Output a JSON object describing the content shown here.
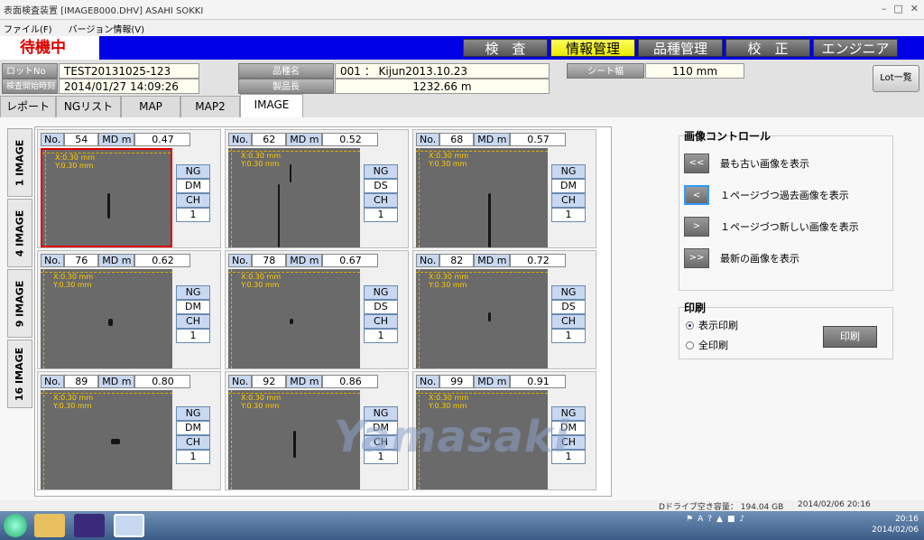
{
  "window": {
    "title": "表面検査装置 [IMAGE8000.DHV] ASAHI SOKKI"
  },
  "menu": [
    "ファイル(F)",
    "バージョン情報(V)"
  ],
  "status": {
    "text": "待機中"
  },
  "nav": [
    {
      "label": "検　査",
      "active": false
    },
    {
      "label": "情報管理",
      "active": true
    },
    {
      "label": "品種管理",
      "active": false
    },
    {
      "label": "校　正",
      "active": false
    },
    {
      "label": "エンジニア",
      "active": false
    }
  ],
  "info": {
    "lot_label": "ロットNo",
    "lot_value": "TEST20131025-123",
    "start_label": "検査開始時刻",
    "start_value": "2014/01/27 14:09:26",
    "kind_label": "品種名",
    "kind_value": "001 ： Kijun2013.10.23",
    "length_label": "製品長",
    "length_value": "1232.66 m",
    "width_label": "シート幅",
    "width_value": "110 mm",
    "lot_list_button": "Lot一覧"
  },
  "tabs": [
    {
      "label": "レポート",
      "active": false
    },
    {
      "label": "NGリスト",
      "active": false
    },
    {
      "label": "MAP",
      "active": false
    },
    {
      "label": "MAP2",
      "active": false
    },
    {
      "label": "IMAGE",
      "active": true
    }
  ],
  "view_tabs": [
    "1 IMAGE",
    "4 IMAGE",
    "9 IMAGE",
    "16 IMAGE"
  ],
  "labels": {
    "no": "No.",
    "md": "MD m",
    "img_x": "X:0.30 mm",
    "img_y": "Y:0.30 mm"
  },
  "images": [
    {
      "no": "54",
      "md": "0.47",
      "badges": [
        "NG",
        "DM",
        "CH",
        "1"
      ],
      "selected": true
    },
    {
      "no": "62",
      "md": "0.52",
      "badges": [
        "NG",
        "DS",
        "CH",
        "1"
      ],
      "selected": false
    },
    {
      "no": "68",
      "md": "0.57",
      "badges": [
        "NG",
        "DM",
        "CH",
        "1"
      ],
      "selected": false
    },
    {
      "no": "76",
      "md": "0.62",
      "badges": [
        "NG",
        "DM",
        "CH",
        "1"
      ],
      "selected": false
    },
    {
      "no": "78",
      "md": "0.67",
      "badges": [
        "NG",
        "DS",
        "CH",
        "1"
      ],
      "selected": false
    },
    {
      "no": "82",
      "md": "0.72",
      "badges": [
        "NG",
        "DS",
        "CH",
        "1"
      ],
      "selected": false
    },
    {
      "no": "89",
      "md": "0.80",
      "badges": [
        "NG",
        "DM",
        "CH",
        "1"
      ],
      "selected": false
    },
    {
      "no": "92",
      "md": "0.86",
      "badges": [
        "NG",
        "DM",
        "CH",
        "1"
      ],
      "selected": false
    },
    {
      "no": "99",
      "md": "0.91",
      "badges": [
        "NG",
        "DM",
        "CH",
        "1"
      ],
      "selected": false
    }
  ],
  "image_control": {
    "title": "画像コントロール",
    "buttons": [
      {
        "icon": "<<",
        "label": "最も古い画像を表示"
      },
      {
        "icon": "<",
        "label": "１ページづつ過去画像を表示"
      },
      {
        "icon": ">",
        "label": "１ページづつ新しい画像を表示"
      },
      {
        "icon": ">>",
        "label": "最新の画像を表示"
      }
    ]
  },
  "print": {
    "title": "印刷",
    "options": [
      {
        "label": "表示印刷",
        "selected": true
      },
      {
        "label": "全印刷",
        "selected": false
      }
    ],
    "button": "印刷"
  },
  "footer": {
    "disk": "Dドライブ空き容量： 194.04 GB",
    "datetime": "2014/02/06 20:16"
  },
  "watermark": "Yamasaki",
  "taskbar": {
    "time": "20:16",
    "date": "2014/02/06"
  }
}
